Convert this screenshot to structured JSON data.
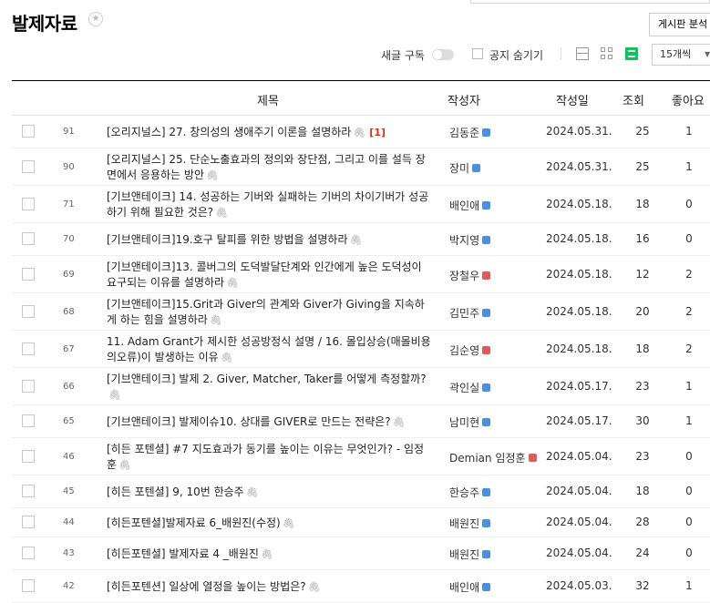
{
  "page": {
    "title": "발제자료"
  },
  "header": {
    "board_search_label": "게시판 분석"
  },
  "toolbar": {
    "new_subscribe_label": "새글 구독",
    "hide_notice_label": "공지 숨기기",
    "per_page": "15개씩"
  },
  "table": {
    "headers": {
      "title": "제목",
      "author": "작성자",
      "date": "작성일",
      "views": "조회",
      "likes": "좋아요"
    },
    "badge_colors": {
      "blue": "#4a90e2",
      "red": "#e05a5a"
    },
    "rows": [
      {
        "num": "91",
        "title": "[오리지널스] 27. 창의성의 생애주기 이론을 설명하라",
        "comments": "[1]",
        "author": "김동준",
        "badge": "blue",
        "date": "2024.05.31.",
        "views": "25",
        "likes": "1"
      },
      {
        "num": "90",
        "title": "[오리지널스] 25. 단순노출효과의 정의와 장단점, 그리고 이를 설득 장면에서 응용하는 방안",
        "comments": "",
        "author": "장미",
        "badge": "blue",
        "date": "2024.05.31.",
        "views": "25",
        "likes": "1"
      },
      {
        "num": "71",
        "title": "[기브앤테이크] 14. 성공하는 기버와 실패하는 기버의 차이기버가 성공하기 위해 필요한 것은?",
        "comments": "",
        "author": "배인애",
        "badge": "blue",
        "date": "2024.05.18.",
        "views": "18",
        "likes": "0"
      },
      {
        "num": "70",
        "title": "[기브앤테이크]19.호구 탈피를 위한 방법을 설명하라",
        "comments": "",
        "author": "박지영",
        "badge": "blue",
        "date": "2024.05.18.",
        "views": "16",
        "likes": "0"
      },
      {
        "num": "69",
        "title": "[기브앤테이크]13. 콜버그의 도덕발달단계와 인간에게 높은 도덕성이 요구되는 이유를 설명하라",
        "comments": "",
        "author": "장철우",
        "badge": "red",
        "date": "2024.05.18.",
        "views": "12",
        "likes": "2"
      },
      {
        "num": "68",
        "title": "[기브앤테이크]15.Grit과 Giver의 관계와 Giver가 Giving을 지속하게 하는 힘을 설명하라",
        "comments": "",
        "author": "김민주",
        "badge": "blue",
        "date": "2024.05.18.",
        "views": "20",
        "likes": "2"
      },
      {
        "num": "67",
        "title": "11. Adam Grant가 제시한 성공방정식 설명 / 16. 몰입상승(매몰비용의오류)이 발생하는 이유",
        "comments": "",
        "author": "김순영",
        "badge": "red",
        "date": "2024.05.18.",
        "views": "18",
        "likes": "2"
      },
      {
        "num": "66",
        "title": "[기브앤테이크] 발제 2. Giver, Matcher, Taker를 어떻게 측정할까?",
        "comments": "",
        "author": "곽인실",
        "badge": "blue",
        "date": "2024.05.17.",
        "views": "23",
        "likes": "1"
      },
      {
        "num": "65",
        "title": "[기브앤테이크] 발제이슈10. 상대를 GIVER로 만드는 전략은?",
        "comments": "",
        "author": "남미현",
        "badge": "blue",
        "date": "2024.05.17.",
        "views": "30",
        "likes": "1"
      },
      {
        "num": "46",
        "title": "[히든 포텐셜] #7 지도효과가 동기를 높이는 이유는 무엇인가? - 임정훈",
        "comments": "",
        "author": "Demian 임정훈",
        "badge": "red",
        "date": "2024.05.04.",
        "views": "23",
        "likes": "0"
      },
      {
        "num": "45",
        "title": "[히든 포텐셜] 9, 10번 한승주",
        "comments": "",
        "author": "한승주",
        "badge": "blue",
        "date": "2024.05.04.",
        "views": "18",
        "likes": "0"
      },
      {
        "num": "44",
        "title": "[히든포텐셜]발제자료 6_배원진(수정)",
        "comments": "",
        "author": "배원진",
        "badge": "blue",
        "date": "2024.05.04.",
        "views": "28",
        "likes": "0"
      },
      {
        "num": "43",
        "title": "[히든포텐셜] 발제자료 4 _배원진",
        "comments": "",
        "author": "배원진",
        "badge": "blue",
        "date": "2024.05.04.",
        "views": "24",
        "likes": "0"
      },
      {
        "num": "42",
        "title": "[히든포텐션] 일상에 열정을 높이는 방법은?",
        "comments": "",
        "author": "배인애",
        "badge": "blue",
        "date": "2024.05.03.",
        "views": "32",
        "likes": "1"
      }
    ]
  }
}
